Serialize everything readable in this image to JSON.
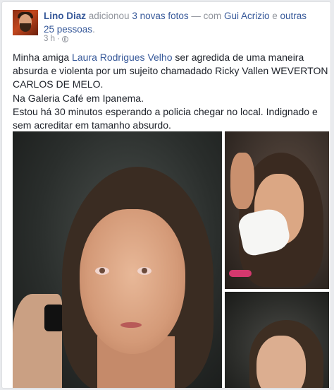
{
  "post": {
    "author": "Lino Diaz",
    "action_prefix": "adicionou",
    "photos_link": "3 novas fotos",
    "with_prefix": "— com",
    "tagged_person": "Gui Acrizio",
    "and_word": "e",
    "others_link_line1": "outras",
    "others_link_line2": "25 pessoas",
    "period": ".",
    "timestamp": "3 h",
    "separator": "·",
    "audience_icon": "globe-icon",
    "text": {
      "line1_prefix": "Minha amiga ",
      "mention": "Laura Rodrigues Velho",
      "line1_suffix": " ser agredida de uma maneira absurda e violenta por um sujeito chamadado Ricky Vallen WEVERTON CARLOS DE MELO.",
      "line2": "Na Galeria Café em Ipanema.",
      "line3": "Estou há 30 minutos esperando a policia chegar no local. Indignado e sem acreditar em tamanho absurdo."
    }
  },
  "colors": {
    "link": "#365899",
    "text": "#1d2129",
    "meta": "#90949c",
    "background": "#e9ebee"
  }
}
